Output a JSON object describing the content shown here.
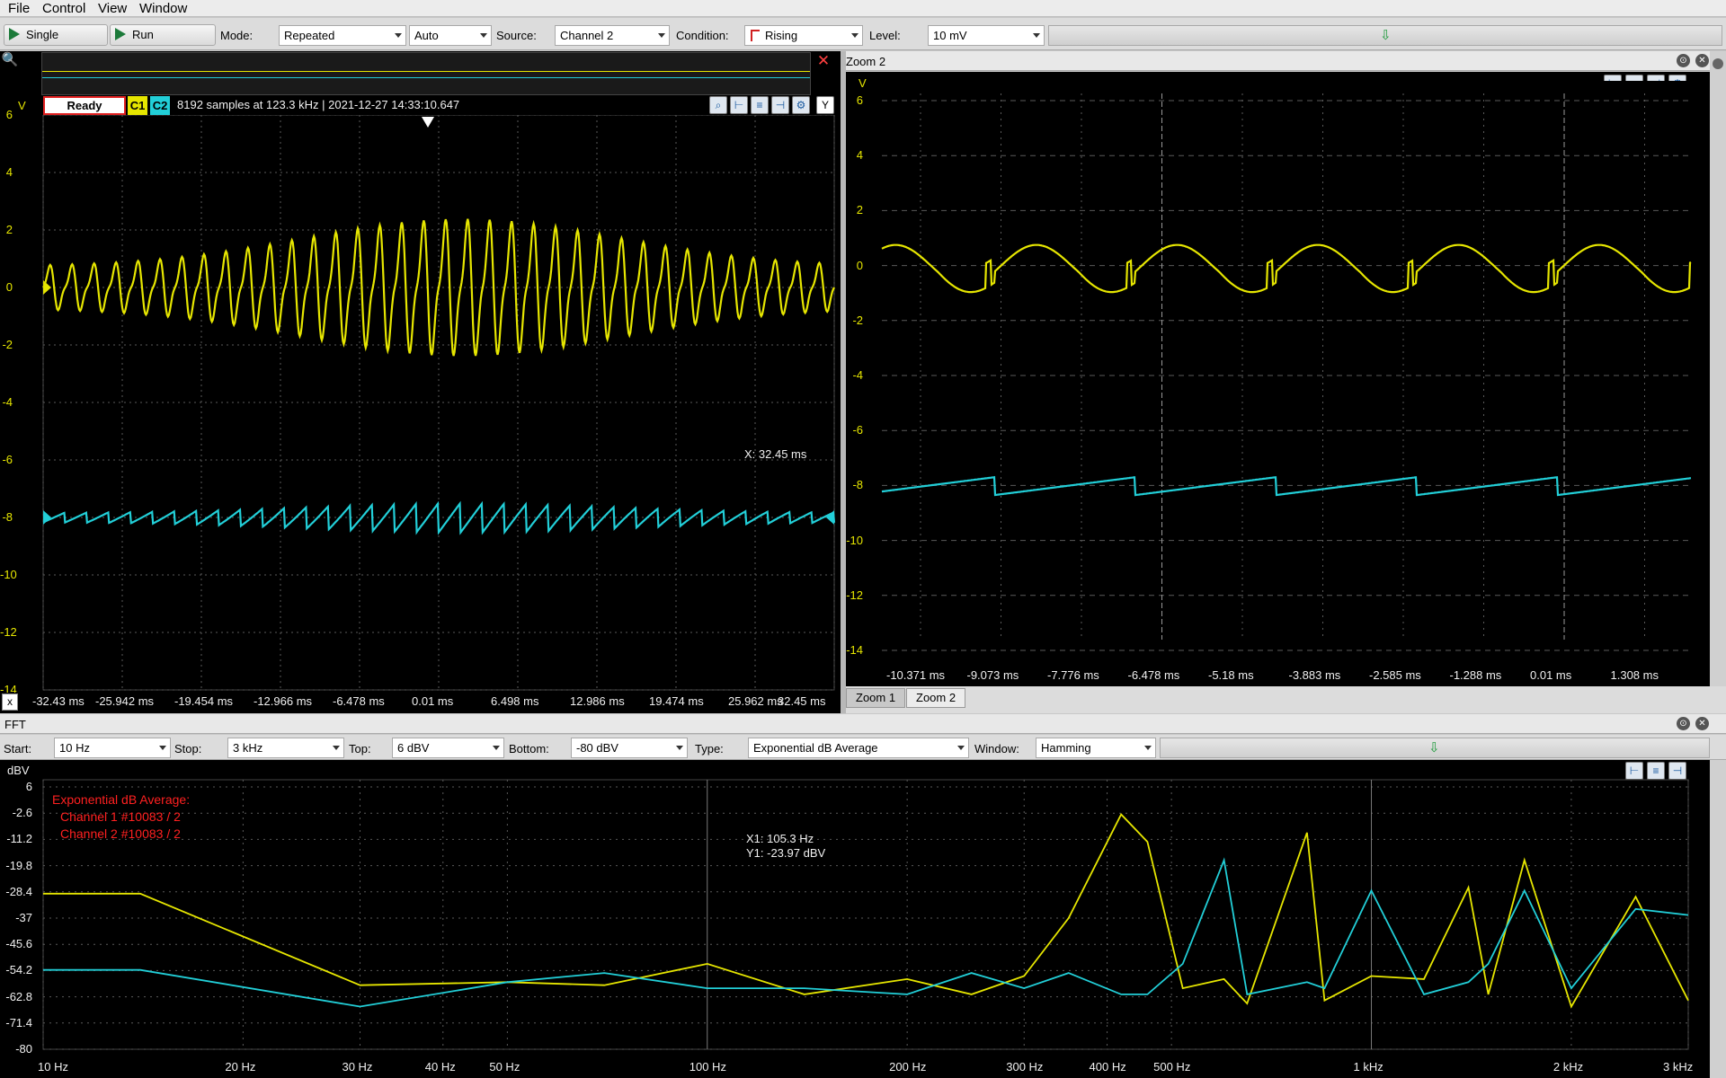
{
  "menu": [
    "File",
    "Control",
    "View",
    "Window"
  ],
  "toolbar": {
    "single": "Single",
    "run": "Run",
    "mode_label": "Mode:",
    "mode_value": "Repeated",
    "auto_value": "Auto",
    "source_label": "Source:",
    "source_value": "Channel 2",
    "condition_label": "Condition:",
    "condition_value": "Rising",
    "level_label": "Level:",
    "level_value": "10 mV"
  },
  "scope": {
    "status": "Ready",
    "c1": "C1",
    "c2": "C2",
    "info": "8192 samples at 123.3 kHz | 2021-12-27 14:33:10.647",
    "unit": "V",
    "y_ticks": [
      "6",
      "4",
      "2",
      "0",
      "-2",
      "-4",
      "-6",
      "-8",
      "-10",
      "-12",
      "-14"
    ],
    "x_ticks": [
      "-32.43 ms",
      "-25.942 ms",
      "-19.454 ms",
      "-12.966 ms",
      "-6.478 ms",
      "0.01 ms",
      "6.498 ms",
      "12.986 ms",
      "19.474 ms",
      "25.962 ms",
      "32.45 ms"
    ],
    "cursor_readout": "X: 32.45 ms",
    "x_btn": "x",
    "y_btn": "Y"
  },
  "zoom": {
    "title": "Zoom 2",
    "unit": "V",
    "y_ticks": [
      "6",
      "4",
      "2",
      "0",
      "-2",
      "-4",
      "-6",
      "-8",
      "-10",
      "-12",
      "-14"
    ],
    "x_ticks": [
      "-10.371 ms",
      "-9.073 ms",
      "-7.776 ms",
      "-6.478 ms",
      "-5.18 ms",
      "-3.883 ms",
      "-2.585 ms",
      "-1.288 ms",
      "0.01 ms",
      "1.308 ms"
    ],
    "tabs": [
      "Zoom 1",
      "Zoom 2"
    ]
  },
  "fft": {
    "title": "FFT",
    "start_label": "Start:",
    "start_value": "10 Hz",
    "stop_label": "Stop:",
    "stop_value": "3 kHz",
    "top_label": "Top:",
    "top_value": "6 dBV",
    "bottom_label": "Bottom:",
    "bottom_value": "-80 dBV",
    "type_label": "Type:",
    "type_value": "Exponential dB Average",
    "window_label": "Window:",
    "window_value": "Hamming",
    "unit": "dBV",
    "y_ticks": [
      "6",
      "-2.6",
      "-11.2",
      "-19.8",
      "-28.4",
      "-37",
      "-45.6",
      "-54.2",
      "-62.8",
      "-71.4",
      "-80"
    ],
    "x_ticks": [
      "10 Hz",
      "20 Hz",
      "30 Hz",
      "40 Hz",
      "50 Hz",
      "100 Hz",
      "200 Hz",
      "300 Hz",
      "400 Hz",
      "500 Hz",
      "1 kHz",
      "2 kHz",
      "3 kHz"
    ],
    "legend_title": "Exponential dB Average:",
    "legend_1": "Channel 1 #10083 / 2",
    "legend_2": "Channel 2 #10083 / 2",
    "cursor_x": "X1: 105.3 Hz",
    "cursor_y": "Y1: -23.97 dBV"
  },
  "colors": {
    "ch1": "#e6e600",
    "ch2": "#22cfd8",
    "legend": "#ff2020",
    "grid": "#5a5a5a"
  },
  "chart_data": [
    {
      "type": "line",
      "title": "",
      "xlabel": "",
      "ylabel": "V",
      "xlim": [
        -32.43,
        32.45
      ],
      "ylim": [
        -14,
        6
      ],
      "series": [
        {
          "name": "C1",
          "offset": 0,
          "amplitude": 1.2,
          "period_ms": 2.6
        },
        {
          "name": "C2",
          "offset": -8,
          "amplitude": 0.4,
          "period_ms": 2.6
        }
      ]
    },
    {
      "type": "line",
      "title": "",
      "xlabel": "",
      "ylabel": "V",
      "xlim": [
        -11.0,
        1.8
      ],
      "ylim": [
        -14,
        6
      ],
      "series": [
        {
          "name": "C1",
          "offset": 0,
          "amplitude": 1.0
        },
        {
          "name": "C2",
          "offset": -8,
          "amplitude": 0.35
        }
      ]
    },
    {
      "type": "line",
      "title": "",
      "xlabel": "",
      "ylabel": "dBV",
      "xlim": [
        10,
        3000
      ],
      "ylim": [
        -80,
        6
      ],
      "xscale": "log",
      "series": [
        {
          "name": "Channel 1 #10083 / 2",
          "x": [
            10,
            14,
            30,
            50,
            70,
            100,
            140,
            200,
            250,
            300,
            350,
            420,
            460,
            520,
            600,
            650,
            800,
            850,
            1000,
            1200,
            1400,
            1500,
            1700,
            2000,
            2500,
            3000
          ],
          "y": [
            -29,
            -29,
            -59,
            -58,
            -59,
            -52,
            -62,
            -57,
            -62,
            -56,
            -37,
            -3,
            -12,
            -60,
            -57,
            -65,
            -9,
            -64,
            -56,
            -57,
            -27,
            -62,
            -18,
            -66,
            -30,
            -64
          ]
        },
        {
          "name": "Channel 2 #10083 / 2",
          "x": [
            10,
            14,
            30,
            50,
            70,
            100,
            140,
            200,
            250,
            300,
            350,
            420,
            460,
            520,
            600,
            650,
            800,
            850,
            1000,
            1200,
            1400,
            1500,
            1700,
            2000,
            2500,
            3000
          ],
          "y": [
            -54,
            -54,
            -66,
            -58,
            -55,
            -60,
            -60,
            -62,
            -55,
            -60,
            -55,
            -62,
            -62,
            -52,
            -18,
            -62,
            -58,
            -60,
            -28,
            -62,
            -58,
            -52,
            -28,
            -60,
            -34,
            -36
          ]
        }
      ]
    }
  ]
}
